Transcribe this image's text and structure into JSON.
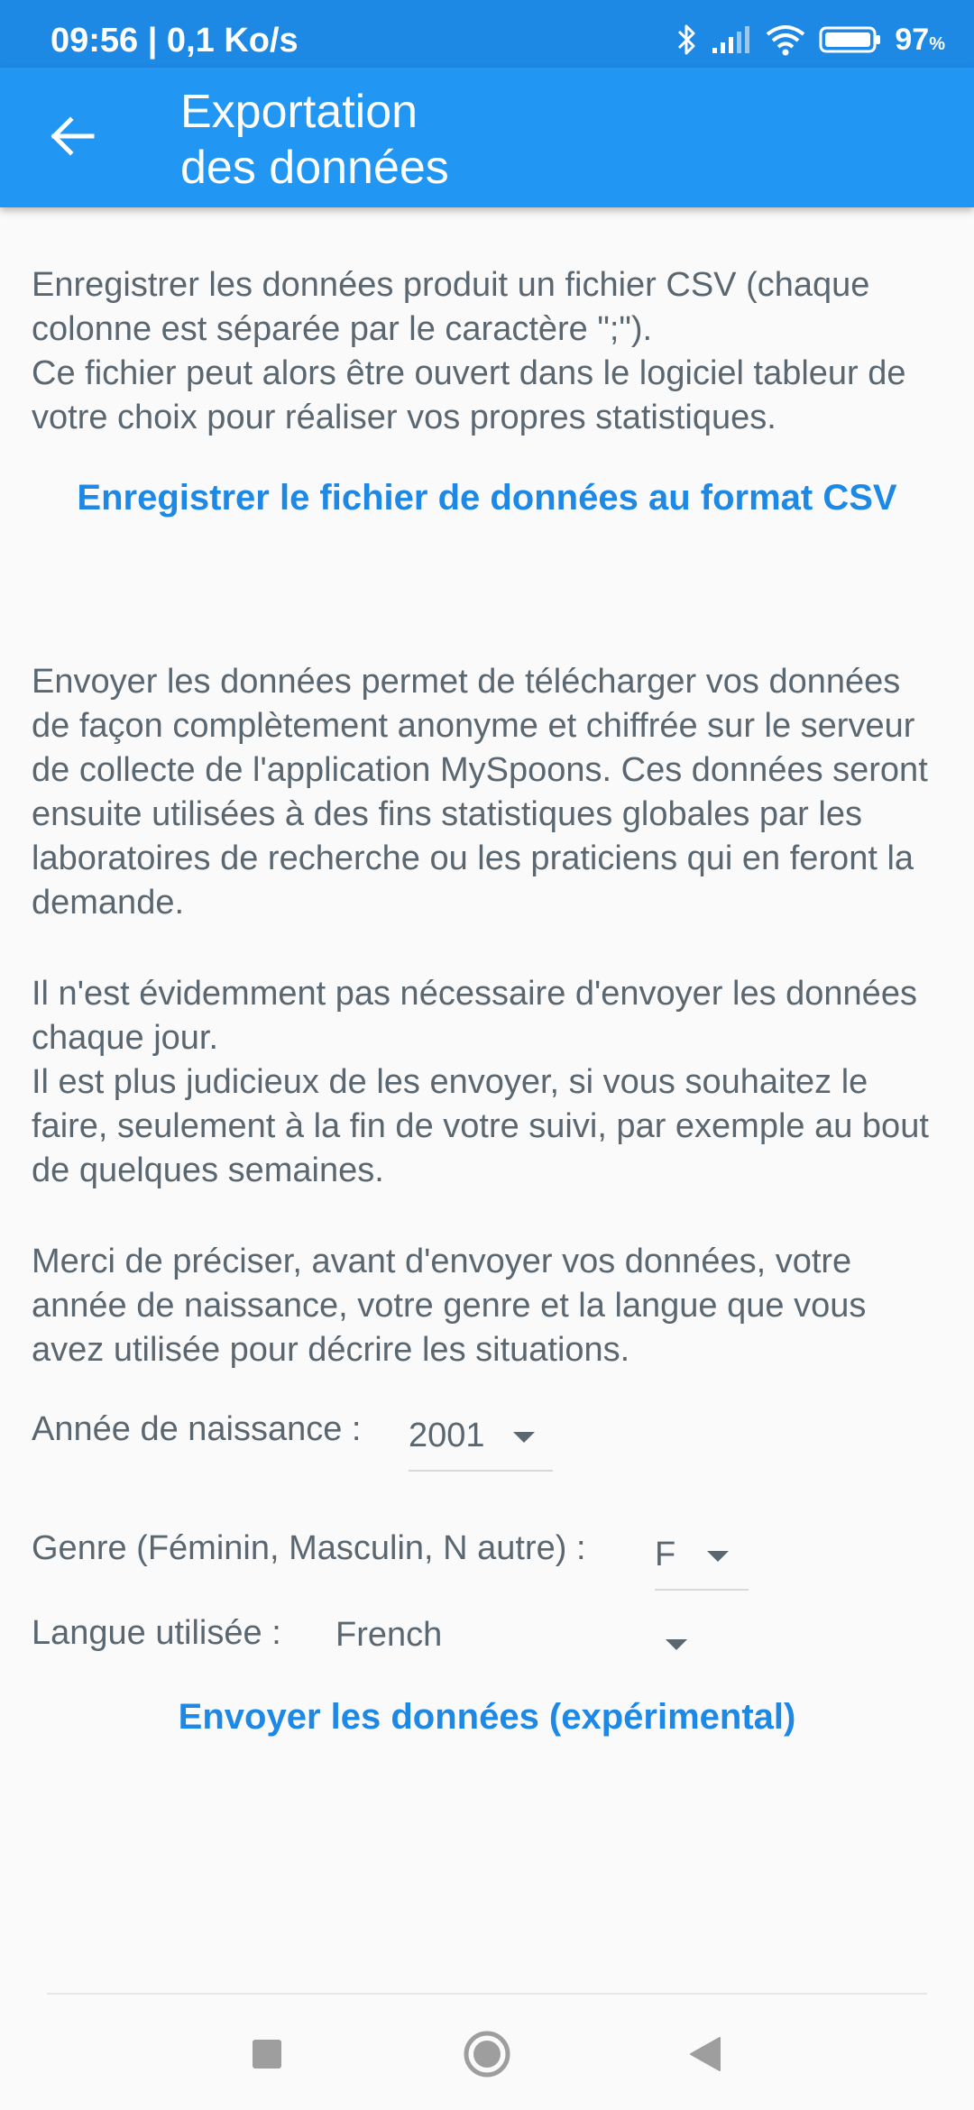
{
  "status_bar": {
    "time": "09:56 | 0,1 Ko/s",
    "battery_percent": "97",
    "battery_unit": "%",
    "icons": [
      "bluetooth-icon",
      "signal-icon",
      "wifi-icon",
      "battery-icon"
    ]
  },
  "app_bar": {
    "back_icon": "arrow-left-icon",
    "title_line1": "Exportation",
    "title_line2": "des données"
  },
  "csv_section": {
    "description_line1": "Enregistrer les données produit un fichier CSV (chaque colonne est séparée par le caractère \";\").",
    "description_line2": "Ce fichier peut alors être ouvert dans le logiciel tableur de votre choix pour réaliser vos propres statistiques.",
    "save_link": "Enregistrer le fichier de données au format CSV"
  },
  "send_section": {
    "para1": "Envoyer les données permet de télécharger vos données de façon complètement anonyme et chiffrée sur le serveur de collecte de l'application MySpoons. Ces données seront ensuite utilisées à des fins statistiques globales par les laboratoires de recherche ou les praticiens qui en feront la demande.",
    "para2_line1": "Il n'est évidemment pas nécessaire d'envoyer les données chaque jour.",
    "para2_line2": "Il est plus judicieux de les envoyer, si vous souhaitez le faire, seulement à la fin de votre suivi, par exemple au bout de quelques semaines.",
    "para3": "Merci de préciser, avant d'envoyer vos données, votre année de naissance, votre genre et la langue que vous avez utilisée pour décrire les situations."
  },
  "form": {
    "birth_year_label": "Année de naissance :",
    "birth_year_value": "2001",
    "gender_label": "Genre (Féminin, Masculin, N autre)  :",
    "gender_value": "F",
    "language_label": "Langue utilisée  :",
    "language_value": "French",
    "send_button": "Envoyer les données (expérimental)"
  },
  "nav_bar": {
    "icons": [
      "recents-square-icon",
      "home-circle-icon",
      "back-triangle-icon"
    ]
  },
  "colors": {
    "status_bar": "#1e88e5",
    "app_bar": "#2196f3",
    "accent_link": "#1e88e5",
    "body_text": "#5b6770",
    "background": "#fafafa"
  }
}
